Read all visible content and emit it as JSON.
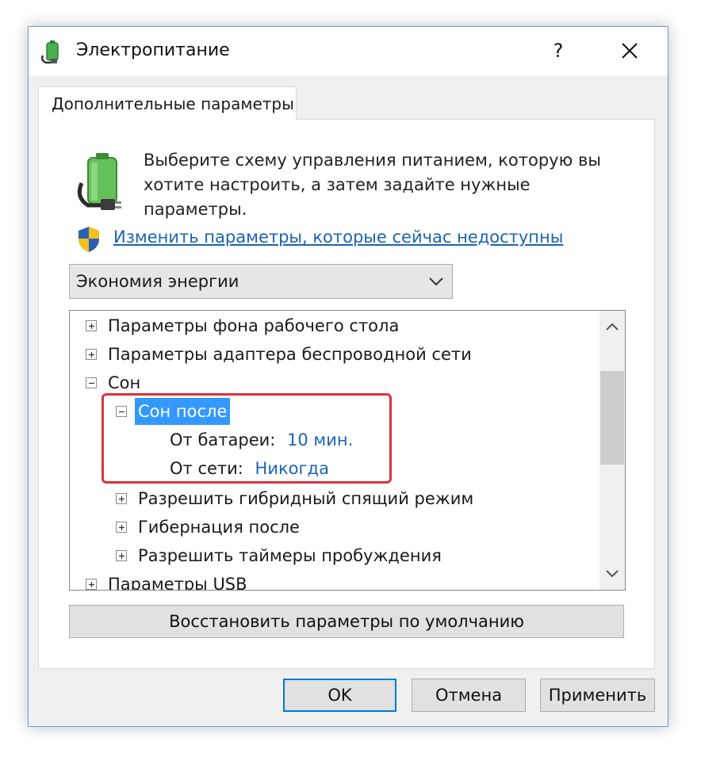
{
  "window": {
    "title": "Электропитание",
    "help_label": "?",
    "close_icon": "close-icon"
  },
  "tab": {
    "label": "Дополнительные параметры"
  },
  "intro": {
    "text": "Выберите схему управления питанием, которую вы хотите настроить, а затем задайте нужные параметры."
  },
  "change_link": {
    "label": "Изменить параметры, которые сейчас недоступны"
  },
  "plan_select": {
    "value": "Экономия энергии"
  },
  "tree": {
    "items": [
      {
        "label": "Параметры фона рабочего стола",
        "expander": "+"
      },
      {
        "label": "Параметры адаптера беспроводной сети",
        "expander": "+"
      },
      {
        "label": "Сон",
        "expander": "−"
      },
      {
        "label": "Сон после",
        "expander": "−"
      },
      {
        "label": "От батареи:",
        "value": "10 мин."
      },
      {
        "label": "От сети:",
        "value": "Никогда"
      },
      {
        "label": "Разрешить гибридный спящий режим",
        "expander": "+"
      },
      {
        "label": "Гибернация после",
        "expander": "+"
      },
      {
        "label": "Разрешить таймеры пробуждения",
        "expander": "+"
      },
      {
        "label": "Параметры USB",
        "expander": "+"
      }
    ]
  },
  "restore_button": {
    "label": "Восстановить параметры по умолчанию"
  },
  "buttons": {
    "ok": "OK",
    "cancel": "Отмена",
    "apply": "Применить"
  },
  "colors": {
    "link": "#1a64b4",
    "selection": "#3399ff",
    "highlight_frame": "#d8343d",
    "accent_border": "#0078d7"
  }
}
